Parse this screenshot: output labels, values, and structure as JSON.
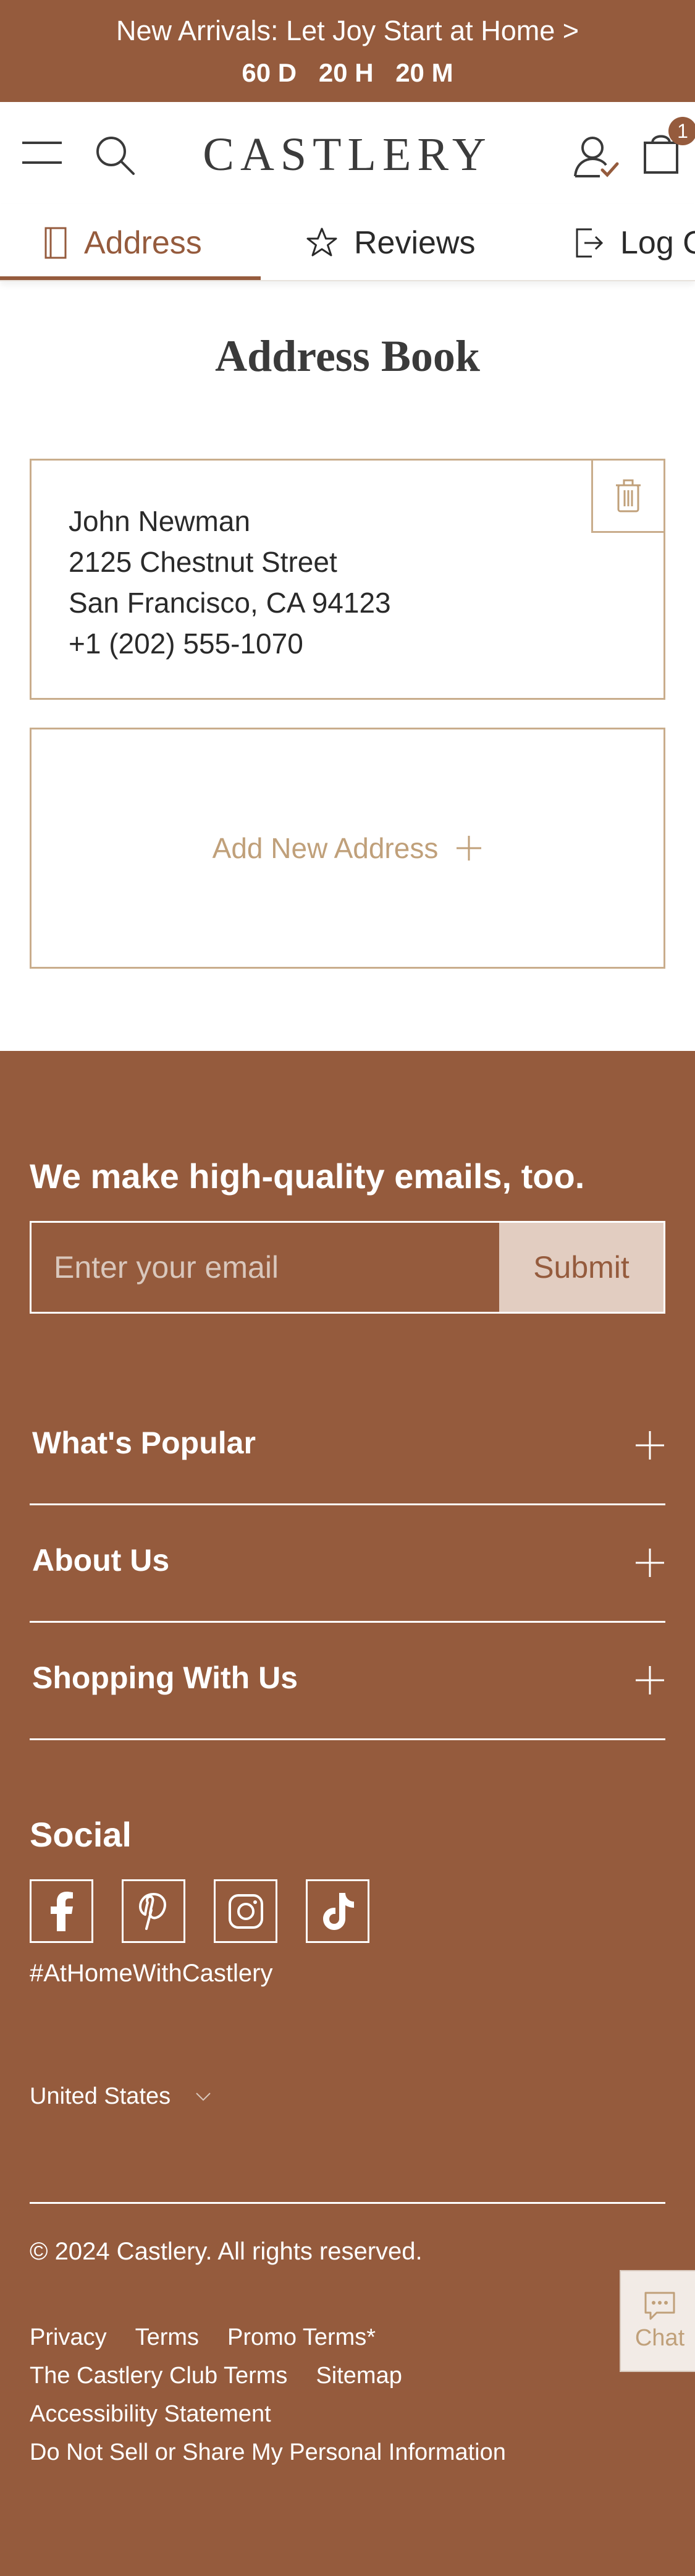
{
  "promo": {
    "text": "New Arrivals: Let Joy Start at Home >",
    "countdown": {
      "days": "60 D",
      "hours": "20 H",
      "minutes": "20 M"
    }
  },
  "header": {
    "logo": "CASTLERY",
    "cart_count": "1",
    "icons": [
      "menu-icon",
      "search-icon",
      "account-icon",
      "cart-icon"
    ]
  },
  "tabs": {
    "address": "Address",
    "reviews": "Reviews",
    "logout": "Log Out",
    "active": "Address"
  },
  "page": {
    "title": "Address Book"
  },
  "address": {
    "name": "John Newman",
    "street": "2125 Chestnut Street",
    "city": "San Francisco, CA 94123",
    "phone": "+1 (202) 555-1070"
  },
  "add_address": {
    "label": "Add New Address"
  },
  "footer": {
    "newsletter_title": "We make high-quality emails, too.",
    "email_placeholder": "Enter your email",
    "submit_label": "Submit",
    "sections": [
      "What's Popular",
      "About Us",
      "Shopping With Us"
    ],
    "social_title": "Social",
    "social_icons": [
      "facebook-icon",
      "pinterest-icon",
      "instagram-icon",
      "tiktok-icon"
    ],
    "hashtag": "#AtHomeWithCastlery",
    "country": "United States",
    "copyright": "© 2024 Castlery. All rights reserved.",
    "links": {
      "privacy": "Privacy",
      "terms": "Terms",
      "promo_terms": "Promo Terms*",
      "club_terms": "The Castlery Club Terms",
      "sitemap": "Sitemap",
      "accessibility": "Accessibility Statement",
      "do_not_sell": "Do Not Sell or Share My Personal Information"
    }
  },
  "chat": {
    "label": "Chat"
  },
  "colors": {
    "brand": "#955b3d",
    "card_border": "#c9ad8c",
    "muted_gold": "#c0a07a",
    "submit_bg": "#e2cdc1"
  }
}
